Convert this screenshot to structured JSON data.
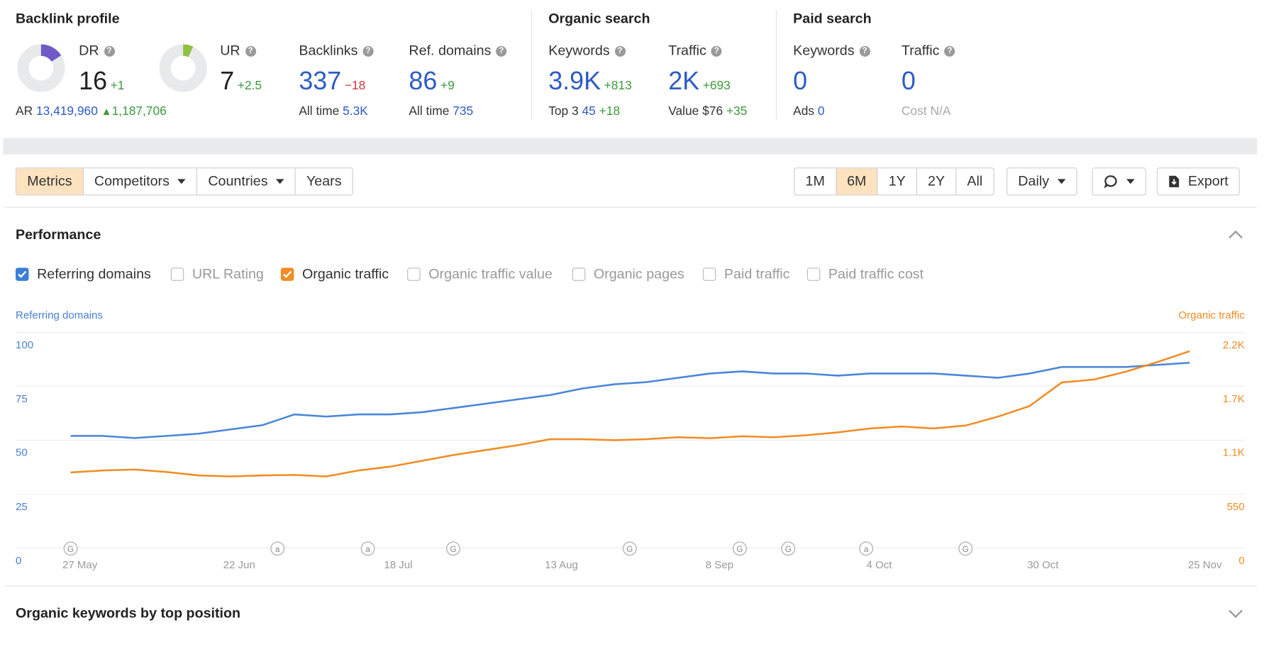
{
  "backlink_profile": {
    "title": "Backlink profile",
    "dr": {
      "label": "DR",
      "value": "16",
      "delta": "+1",
      "fraction": 0.16
    },
    "ur": {
      "label": "UR",
      "value": "7",
      "delta": "+2.5",
      "fraction": 0.07
    },
    "ar": {
      "label": "AR",
      "value": "13,419,960",
      "delta": "1,187,706"
    },
    "backlinks": {
      "label": "Backlinks",
      "value": "337",
      "delta": "−18",
      "sub_label": "All time",
      "sub_value": "5.3K"
    },
    "ref_domains": {
      "label": "Ref. domains",
      "value": "86",
      "delta": "+9",
      "sub_label": "All time",
      "sub_value": "735"
    }
  },
  "organic_search": {
    "title": "Organic search",
    "keywords": {
      "label": "Keywords",
      "value": "3.9K",
      "delta": "+813",
      "sub_label": "Top 3",
      "sub_value": "45",
      "sub_delta": "+18"
    },
    "traffic": {
      "label": "Traffic",
      "value": "2K",
      "delta": "+693",
      "sub_label": "Value",
      "sub_value": "$76",
      "sub_delta": "+35"
    }
  },
  "paid_search": {
    "title": "Paid search",
    "keywords": {
      "label": "Keywords",
      "value": "0",
      "sub_label": "Ads",
      "sub_value": "0"
    },
    "traffic": {
      "label": "Traffic",
      "value": "0",
      "sub_label": "Cost",
      "sub_value": "N/A"
    }
  },
  "toolbar": {
    "left_tabs": [
      "Metrics",
      "Competitors",
      "Countries",
      "Years"
    ],
    "ranges": [
      "1M",
      "6M",
      "1Y",
      "2Y",
      "All"
    ],
    "active_range": "6M",
    "granularity": "Daily",
    "export": "Export"
  },
  "performance": {
    "title": "Performance",
    "checkboxes": [
      {
        "label": "Referring domains",
        "checked": true
      },
      {
        "label": "URL Rating",
        "checked": false
      },
      {
        "label": "Organic traffic",
        "checked": true
      },
      {
        "label": "Organic traffic value",
        "checked": false
      },
      {
        "label": "Organic pages",
        "checked": false
      },
      {
        "label": "Paid traffic",
        "checked": false
      },
      {
        "label": "Paid traffic cost",
        "checked": false
      }
    ]
  },
  "bottom_section": {
    "title": "Organic keywords by top position"
  },
  "colors": {
    "blue": "#4a86d8",
    "orange": "#f08c25",
    "active_tab": "#fde2bf"
  },
  "chart_data": {
    "type": "line",
    "y_left_label": "Referring domains",
    "y_right_label": "Organic traffic",
    "y_left_ticks": [
      "0",
      "25",
      "50",
      "75",
      "100"
    ],
    "y_right_ticks": [
      "0",
      "550",
      "1.1K",
      "1.7K",
      "2.2K"
    ],
    "ylim_left": [
      0,
      100
    ],
    "ylim_right": [
      0,
      2200
    ],
    "x_ticks": [
      "27 May",
      "22 Jun",
      "18 Jul",
      "13 Aug",
      "8 Sep",
      "4 Oct",
      "30 Oct",
      "25 Nov"
    ],
    "x": [
      "27 May",
      "1 Jun",
      "6 Jun",
      "11 Jun",
      "16 Jun",
      "22 Jun",
      "27 Jun",
      "2 Jul",
      "7 Jul",
      "12 Jul",
      "18 Jul",
      "23 Jul",
      "28 Jul",
      "2 Aug",
      "8 Aug",
      "13 Aug",
      "18 Aug",
      "23 Aug",
      "28 Aug",
      "3 Sep",
      "8 Sep",
      "13 Sep",
      "18 Sep",
      "23 Sep",
      "28 Sep",
      "4 Oct",
      "9 Oct",
      "14 Oct",
      "19 Oct",
      "24 Oct",
      "30 Oct",
      "4 Nov",
      "9 Nov",
      "14 Nov",
      "19 Nov",
      "25 Nov"
    ],
    "series": [
      {
        "name": "Referring domains",
        "axis": "left",
        "values": [
          52,
          52,
          51,
          52,
          53,
          55,
          57,
          62,
          61,
          62,
          62,
          63,
          65,
          67,
          69,
          71,
          74,
          76,
          77,
          79,
          81,
          82,
          81,
          81,
          80,
          81,
          81,
          81,
          80,
          79,
          81,
          84,
          84,
          84,
          85,
          86
        ]
      },
      {
        "name": "Organic traffic",
        "axis": "right",
        "values": [
          770,
          790,
          800,
          775,
          740,
          730,
          740,
          745,
          730,
          790,
          830,
          890,
          950,
          1000,
          1050,
          1110,
          1110,
          1100,
          1110,
          1130,
          1120,
          1140,
          1130,
          1150,
          1180,
          1220,
          1240,
          1220,
          1250,
          1340,
          1450,
          1690,
          1720,
          1800,
          1900,
          2010
        ]
      }
    ],
    "annotations": [
      "G",
      "a",
      "a",
      "G",
      "G",
      "G",
      "G",
      "a",
      "G"
    ],
    "grid": true
  }
}
